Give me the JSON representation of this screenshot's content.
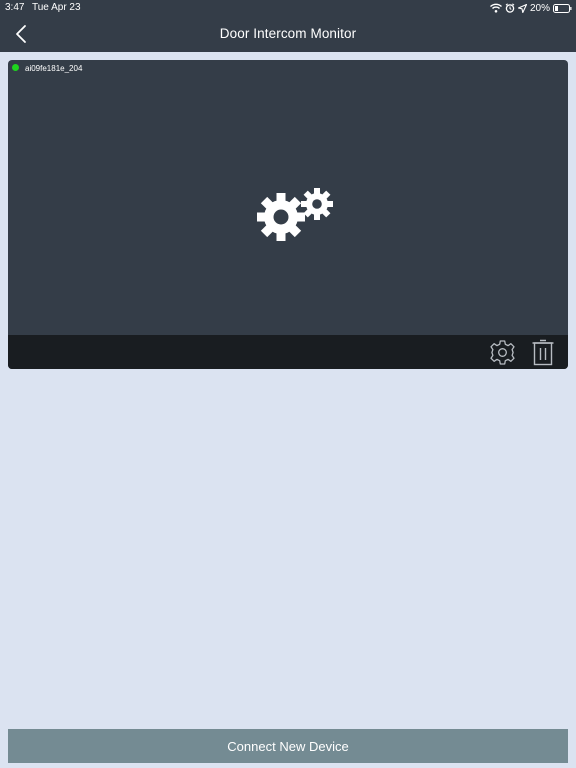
{
  "status_bar": {
    "time": "3:47",
    "date": "Tue Apr 23",
    "battery": "20%",
    "icons": [
      "wifi-icon",
      "alarm-icon",
      "location-icon",
      "battery-icon"
    ]
  },
  "nav": {
    "title": "Door Intercom Monitor",
    "back_icon": "chevron-left-icon"
  },
  "device": {
    "name": "ai09fe181e_204",
    "status": "online",
    "status_color": "#1ed41e",
    "preview_icon": "gears-icon",
    "actions": [
      "gear-icon",
      "trash-icon"
    ]
  },
  "footer": {
    "connect_label": "Connect New Device"
  },
  "colors": {
    "header": "#343d48",
    "background": "#dbe3f1",
    "card": "#343d48",
    "card_toolbar": "#191d21",
    "button": "#748b93"
  }
}
